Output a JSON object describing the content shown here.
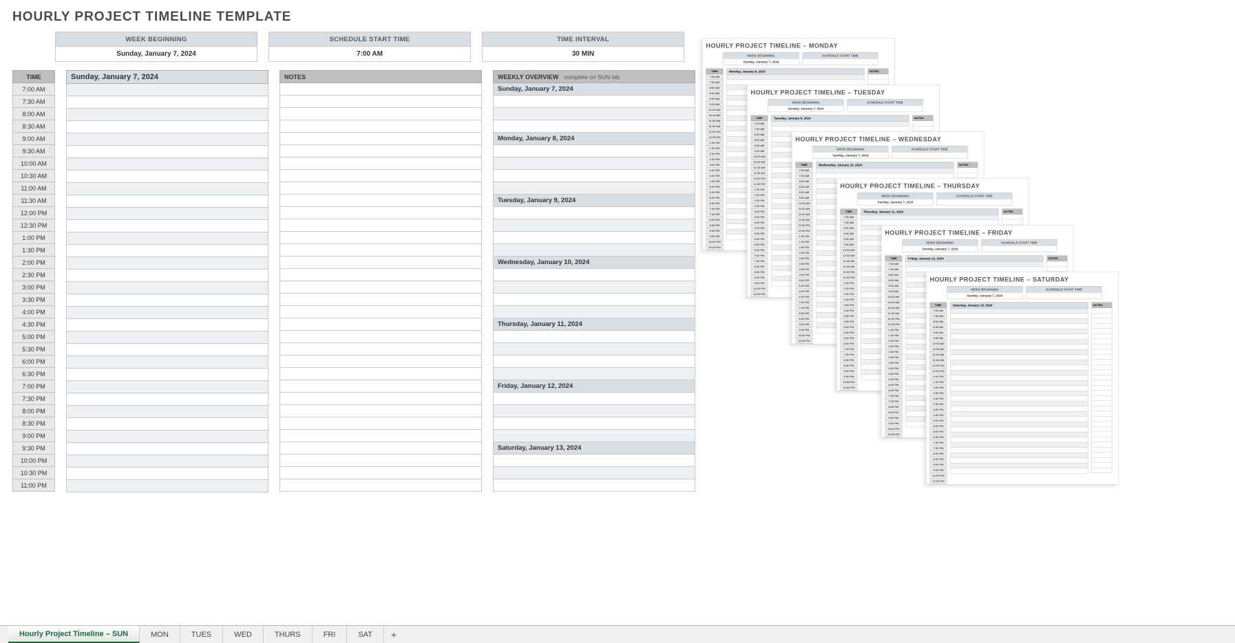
{
  "title": "HOURLY PROJECT TIMELINE TEMPLATE",
  "banners": {
    "week_beginning": {
      "label": "WEEK BEGINNING",
      "value": "Sunday, January 7, 2024"
    },
    "start_time": {
      "label": "SCHEDULE START TIME",
      "value": "7:00 AM"
    },
    "interval": {
      "label": "TIME INTERVAL",
      "value": "30 MIN"
    }
  },
  "headers": {
    "time": "TIME",
    "notes": "NOTES",
    "overview": "WEEKLY OVERVIEW",
    "overview_sub": "complete on SUN tab"
  },
  "day_header": "Sunday, January 7, 2024",
  "times": [
    "7:00 AM",
    "7:30 AM",
    "8:00 AM",
    "8:30 AM",
    "9:00 AM",
    "9:30 AM",
    "10:00 AM",
    "10:30 AM",
    "11:00 AM",
    "11:30 AM",
    "12:00 PM",
    "12:30 PM",
    "1:00 PM",
    "1:30 PM",
    "2:00 PM",
    "2:30 PM",
    "3:00 PM",
    "3:30 PM",
    "4:00 PM",
    "4:30 PM",
    "5:00 PM",
    "5:30 PM",
    "6:00 PM",
    "6:30 PM",
    "7:00 PM",
    "7:30 PM",
    "8:00 PM",
    "8:30 PM",
    "9:00 PM",
    "9:30 PM",
    "10:00 PM",
    "10:30 PM",
    "11:00 PM"
  ],
  "week_days": [
    "Sunday, January 7, 2024",
    "Monday, January 8, 2024",
    "Tuesday, January 9, 2024",
    "Wednesday, January 10, 2024",
    "Thursday, January 11, 2024",
    "Friday, January 12, 2024",
    "Saturday, January 13, 2024"
  ],
  "thumbnails": [
    {
      "title": "HOURLY PROJECT TIMELINE  –  MONDAY",
      "date": "Monday, January 8, 2024"
    },
    {
      "title": "HOURLY PROJECT TIMELINE  –  TUESDAY",
      "date": "Tuesday, January 9, 2024"
    },
    {
      "title": "HOURLY PROJECT TIMELINE  –  WEDNESDAY",
      "date": "Wednesday, January 10, 2024"
    },
    {
      "title": "HOURLY PROJECT TIMELINE  –  THURSDAY",
      "date": "Thursday, January 11, 2024"
    },
    {
      "title": "HOURLY PROJECT TIMELINE  –  FRIDAY",
      "date": "Friday, January 12, 2024"
    },
    {
      "title": "HOURLY PROJECT TIMELINE  –  SATURDAY",
      "date": "Saturday, January 13, 2024"
    }
  ],
  "thumb_labels": {
    "week_beginning": "WEEK BEGINNING",
    "week_beginning_val": "Sunday, January 7, 2024",
    "start_time": "SCHEDULE START TIME",
    "time": "TIME",
    "notes": "NOTES"
  },
  "thumb_times": [
    "7:00 AM",
    "7:30 AM",
    "8:00 AM",
    "8:30 AM",
    "9:00 AM",
    "9:30 AM",
    "10:00 AM",
    "10:30 AM",
    "11:00 AM",
    "11:30 AM",
    "12:00 PM",
    "12:30 PM",
    "1:00 PM",
    "1:30 PM",
    "2:00 PM",
    "2:30 PM",
    "3:00 PM",
    "3:30 PM",
    "4:00 PM",
    "4:30 PM",
    "5:00 PM",
    "5:30 PM",
    "6:00 PM",
    "6:30 PM",
    "7:00 PM",
    "7:30 PM",
    "8:00 PM",
    "8:30 PM",
    "9:00 PM",
    "9:30 PM",
    "10:00 PM",
    "10:30 PM"
  ],
  "tabs": [
    "Hourly Project Timeline – SUN",
    "MON",
    "TUES",
    "WED",
    "THURS",
    "FRI",
    "SAT"
  ],
  "active_tab": 0,
  "plus": "+"
}
